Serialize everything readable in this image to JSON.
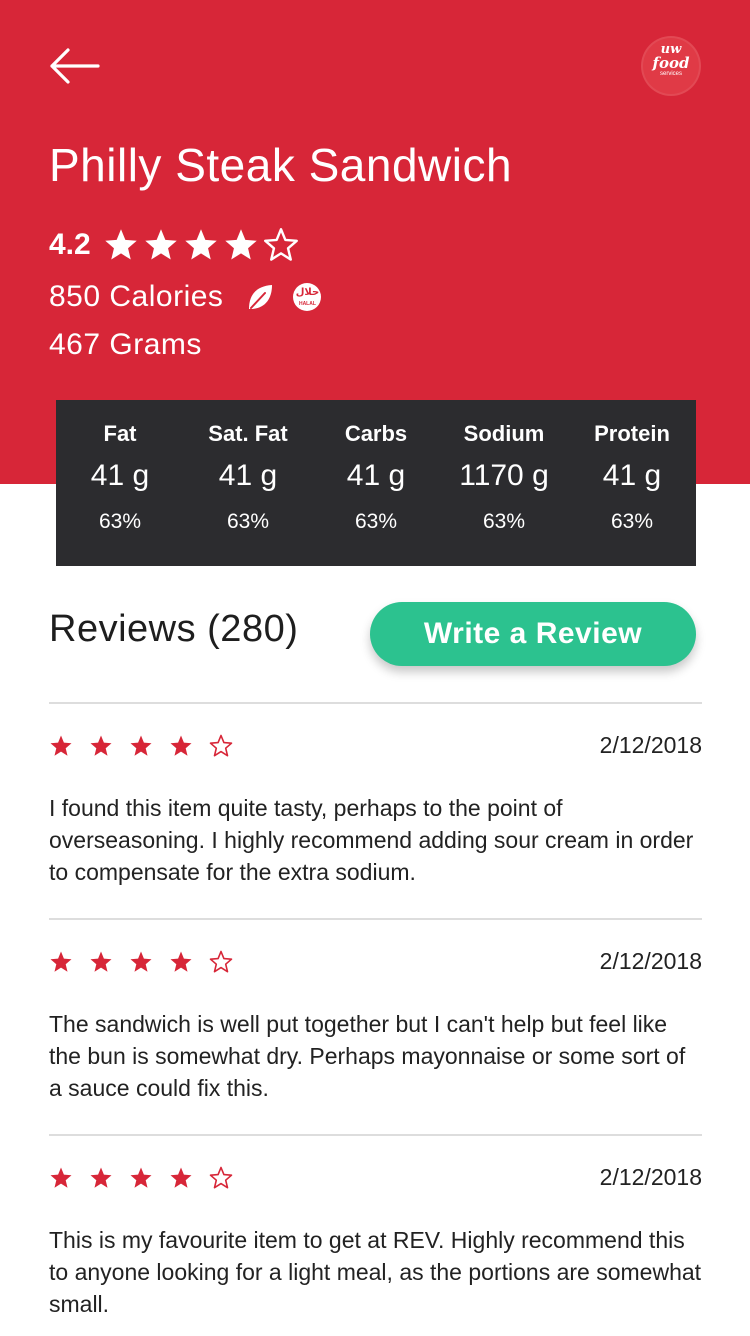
{
  "header": {
    "back_icon": "arrow-left-icon",
    "logo": {
      "line1": "uw",
      "line2": "food",
      "line3": "services"
    },
    "accent_color": "#d72638"
  },
  "item": {
    "name": "Philly Steak Sandwich",
    "rating": "4.2",
    "rating_stars": 4,
    "max_stars": 5,
    "calories": "850 Calories",
    "weight": "467 Grams",
    "badges": [
      "leaf-icon",
      "halal-icon"
    ],
    "halal_label": "HALAL",
    "halal_arabic": "حلال"
  },
  "nutrition": [
    {
      "label": "Fat",
      "amount": "41 g",
      "percent": "63%"
    },
    {
      "label": "Sat. Fat",
      "amount": "41 g",
      "percent": "63%"
    },
    {
      "label": "Carbs",
      "amount": "41 g",
      "percent": "63%"
    },
    {
      "label": "Sodium",
      "amount": "1170 g",
      "percent": "63%"
    },
    {
      "label": "Protein",
      "amount": "41 g",
      "percent": "63%"
    }
  ],
  "reviews_section": {
    "heading": "Reviews (280)",
    "write_button": "Write a Review",
    "button_color": "#2cc28f"
  },
  "reviews": [
    {
      "stars": 4,
      "date": "2/12/2018",
      "text": "I found this item quite tasty, perhaps to the point of overseasoning. I highly recommend adding sour cream in order to compensate for the extra sodium."
    },
    {
      "stars": 4,
      "date": "2/12/2018",
      "text": "The sandwich is well put together but I can't help but feel like the bun is somewhat dry. Perhaps mayonnaise or some sort of a sauce could fix this."
    },
    {
      "stars": 4,
      "date": "2/12/2018",
      "text": "This is my favourite item to get at REV. Highly recommend this to anyone looking for a light meal, as the portions are somewhat small."
    }
  ]
}
